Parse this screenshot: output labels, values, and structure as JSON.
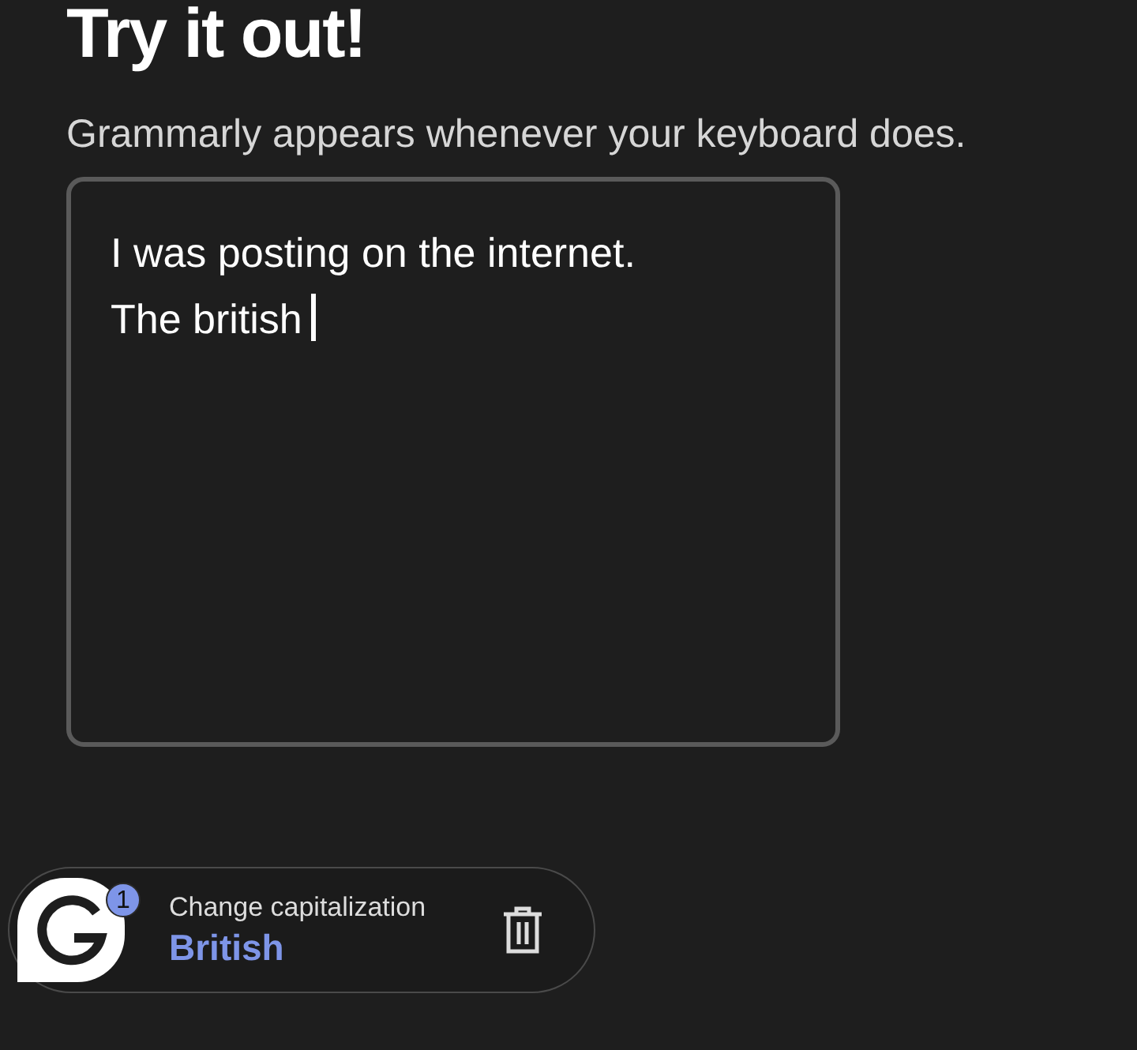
{
  "title": "Try it out!",
  "subtitle": "Grammarly appears whenever your keyboard does.",
  "text_area": {
    "value": "I was posting on the internet.\nThe british"
  },
  "suggestion": {
    "badge": "1",
    "label": "Change capitalization",
    "replacement": "British"
  }
}
